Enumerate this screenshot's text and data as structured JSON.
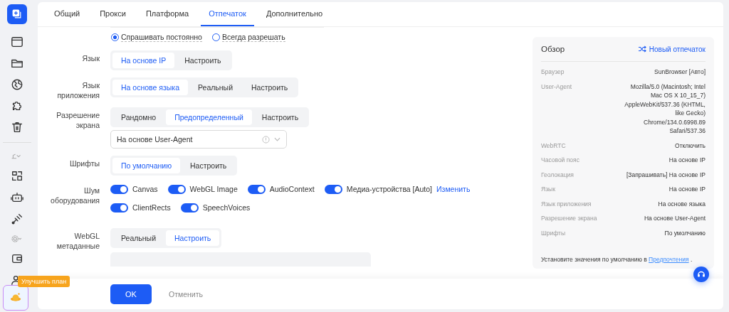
{
  "sidebar": {
    "upgrade_tooltip": "Улучшить план"
  },
  "tabs": [
    {
      "label": "Общий",
      "selected": false
    },
    {
      "label": "Прокси",
      "selected": false
    },
    {
      "label": "Платформа",
      "selected": false
    },
    {
      "label": "Отпечаток",
      "selected": true
    },
    {
      "label": "Дополнительно",
      "selected": false
    }
  ],
  "geolocation_options": [
    {
      "label": "Спрашивать постоянно",
      "selected": true
    },
    {
      "label": "Всегда разрешать",
      "selected": false
    }
  ],
  "rows": [
    {
      "kind": "segmented",
      "label": "Язык",
      "options": [
        {
          "label": "На основе IP",
          "selected": true
        },
        {
          "label": "Настроить",
          "selected": false
        }
      ]
    },
    {
      "kind": "segmented",
      "label": "Язык приложения",
      "options": [
        {
          "label": "На основе языка",
          "selected": true
        },
        {
          "label": "Реальный",
          "selected": false
        },
        {
          "label": "Настроить",
          "selected": false
        }
      ]
    },
    {
      "kind": "segmented",
      "label": "Разрешение экрана",
      "options": [
        {
          "label": "Рандомно",
          "selected": false
        },
        {
          "label": "Предопределенный",
          "selected": true
        },
        {
          "label": "Настроить",
          "selected": false
        }
      ],
      "select": {
        "value": "На основе User-Agent"
      }
    },
    {
      "kind": "segmented",
      "label": "Шрифты",
      "options": [
        {
          "label": "По умолчанию",
          "selected": true
        },
        {
          "label": "Настроить",
          "selected": false
        }
      ]
    },
    {
      "kind": "toggles",
      "label": "Шум оборудования",
      "toggles": [
        {
          "label": "Canvas",
          "on": true
        },
        {
          "label": "WebGL Image",
          "on": true
        },
        {
          "label": "AudioContext",
          "on": true
        },
        {
          "label": "Медиа-устройства [Auto]",
          "on": true
        },
        {
          "label": "ClientRects",
          "on": true
        },
        {
          "label": "SpeechVoices",
          "on": true
        }
      ],
      "link": "Изменить"
    },
    {
      "kind": "segmented",
      "label": "WebGL метаданные",
      "options": [
        {
          "label": "Реальный",
          "selected": false
        },
        {
          "label": "Настроить",
          "selected": true
        }
      ],
      "panel_below": true
    }
  ],
  "overview": {
    "title": "Обзор",
    "action": "Новый отпечаток",
    "items": [
      {
        "label": "Браузер",
        "value": "SunBrowser [Авто]"
      },
      {
        "label": "User-Agent",
        "value": "Mozilla/5.0 (Macintosh; Intel Mac OS X 10_15_7) AppleWebKit/537.36 (KHTML, like Gecko) Chrome/134.0.6998.89 Safari/537.36"
      },
      {
        "label": "WebRTC",
        "value": "Отключить"
      },
      {
        "label": "Часовой пояс",
        "value": "На основе IP"
      },
      {
        "label": "Геолокация",
        "value": "[Запрашивать] На основе IP"
      },
      {
        "label": "Язык",
        "value": "На основе IP"
      },
      {
        "label": "Язык приложения",
        "value": "На основе языка"
      },
      {
        "label": "Разрешение экрана",
        "value": "На основе User-Agent"
      },
      {
        "label": "Шрифты",
        "value": "По умолчанию"
      }
    ],
    "footer_text": "Установите значения по умолчанию в ",
    "footer_link": "Предпочтения",
    "footer_end": " ."
  },
  "footer": {
    "ok": "OK",
    "cancel": "Отменить"
  }
}
